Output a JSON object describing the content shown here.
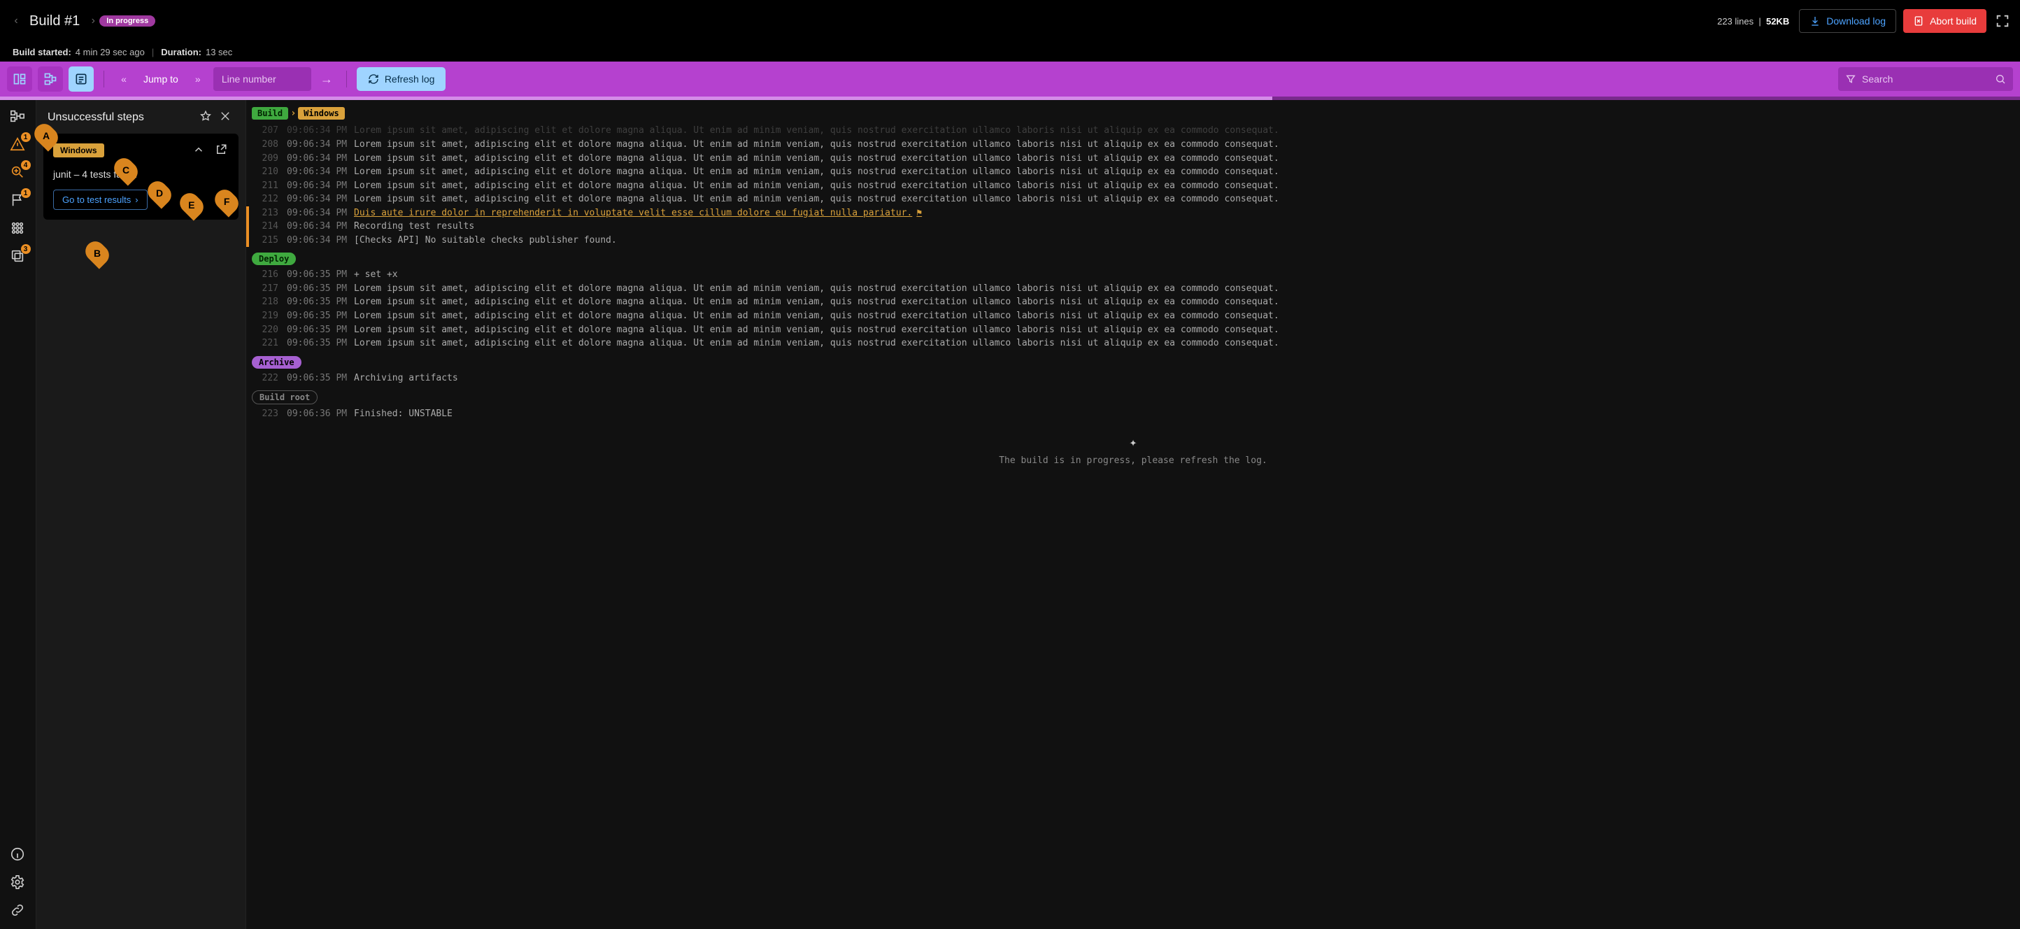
{
  "header": {
    "title": "Build #1",
    "status_badge": "In progress",
    "lines": "223 lines",
    "size": "52KB",
    "download_label": "Download log",
    "abort_label": "Abort build"
  },
  "subheader": {
    "started_label": "Build started:",
    "started_value": "4 min 29 sec ago",
    "sep": "|",
    "duration_label": "Duration:",
    "duration_value": "13 sec"
  },
  "toolbar": {
    "jump_label": "Jump to",
    "line_placeholder": "Line number",
    "refresh_label": "Refresh log",
    "search_placeholder": "Search"
  },
  "progress_percent": 63,
  "rail_badges": {
    "warning": "1",
    "search": "4",
    "flag": "1",
    "copies": "3"
  },
  "sidepanel": {
    "title": "Unsuccessful steps",
    "card": {
      "tag": "Windows",
      "failure_line": "junit – 4 tests failed",
      "cta_label": "Go to test results"
    }
  },
  "callouts": [
    "A",
    "B",
    "C",
    "D",
    "E",
    "F"
  ],
  "breadcrumb": {
    "stage": "Build",
    "sub": "Windows"
  },
  "stages": {
    "deploy": "Deploy",
    "archive": "Archive",
    "root": "Build root"
  },
  "log": {
    "prev_faded": {
      "ln": "207",
      "ts": "09:06:34 PM",
      "msg": "Lorem ipsum sit amet, adipiscing elit et dolore magna aliqua. Ut enim ad minim veniam, quis nostrud exercitation ullamco laboris nisi ut aliquip ex ea commodo consequat."
    },
    "build_lines": [
      {
        "ln": "208",
        "ts": "09:06:34 PM",
        "msg": "Lorem ipsum sit amet, adipiscing elit et dolore magna aliqua. Ut enim ad minim veniam, quis nostrud exercitation ullamco laboris nisi ut aliquip ex ea commodo consequat."
      },
      {
        "ln": "209",
        "ts": "09:06:34 PM",
        "msg": "Lorem ipsum sit amet, adipiscing elit et dolore magna aliqua. Ut enim ad minim veniam, quis nostrud exercitation ullamco laboris nisi ut aliquip ex ea commodo consequat."
      },
      {
        "ln": "210",
        "ts": "09:06:34 PM",
        "msg": "Lorem ipsum sit amet, adipiscing elit et dolore magna aliqua. Ut enim ad minim veniam, quis nostrud exercitation ullamco laboris nisi ut aliquip ex ea commodo consequat."
      },
      {
        "ln": "211",
        "ts": "09:06:34 PM",
        "msg": "Lorem ipsum sit amet, adipiscing elit et dolore magna aliqua. Ut enim ad minim veniam, quis nostrud exercitation ullamco laboris nisi ut aliquip ex ea commodo consequat."
      },
      {
        "ln": "212",
        "ts": "09:06:34 PM",
        "msg": "Lorem ipsum sit amet, adipiscing elit et dolore magna aliqua. Ut enim ad minim veniam, quis nostrud exercitation ullamco laboris nisi ut aliquip ex ea commodo consequat."
      }
    ],
    "warn_line": {
      "ln": "213",
      "ts": "09:06:34 PM",
      "msg": "Duis aute irure dolor in reprehenderit in voluptate velit esse cillum dolore eu fugiat nulla pariatur."
    },
    "bar_lines": [
      {
        "ln": "214",
        "ts": "09:06:34 PM",
        "msg": "Recording test results"
      },
      {
        "ln": "215",
        "ts": "09:06:34 PM",
        "msg": "[Checks API] No suitable checks publisher found."
      }
    ],
    "deploy_lines": [
      {
        "ln": "216",
        "ts": "09:06:35 PM",
        "msg": "+ set +x"
      },
      {
        "ln": "217",
        "ts": "09:06:35 PM",
        "msg": "Lorem ipsum sit amet, adipiscing elit et dolore magna aliqua. Ut enim ad minim veniam, quis nostrud exercitation ullamco laboris nisi ut aliquip ex ea commodo consequat."
      },
      {
        "ln": "218",
        "ts": "09:06:35 PM",
        "msg": "Lorem ipsum sit amet, adipiscing elit et dolore magna aliqua. Ut enim ad minim veniam, quis nostrud exercitation ullamco laboris nisi ut aliquip ex ea commodo consequat."
      },
      {
        "ln": "219",
        "ts": "09:06:35 PM",
        "msg": "Lorem ipsum sit amet, adipiscing elit et dolore magna aliqua. Ut enim ad minim veniam, quis nostrud exercitation ullamco laboris nisi ut aliquip ex ea commodo consequat."
      },
      {
        "ln": "220",
        "ts": "09:06:35 PM",
        "msg": "Lorem ipsum sit amet, adipiscing elit et dolore magna aliqua. Ut enim ad minim veniam, quis nostrud exercitation ullamco laboris nisi ut aliquip ex ea commodo consequat."
      },
      {
        "ln": "221",
        "ts": "09:06:35 PM",
        "msg": "Lorem ipsum sit amet, adipiscing elit et dolore magna aliqua. Ut enim ad minim veniam, quis nostrud exercitation ullamco laboris nisi ut aliquip ex ea commodo consequat."
      }
    ],
    "archive_lines": [
      {
        "ln": "222",
        "ts": "09:06:35 PM",
        "msg": "Archiving artifacts"
      }
    ],
    "root_lines": [
      {
        "ln": "223",
        "ts": "09:06:36 PM",
        "msg": "Finished: UNSTABLE"
      }
    ],
    "footer": "The build is in progress, please refresh the log."
  }
}
